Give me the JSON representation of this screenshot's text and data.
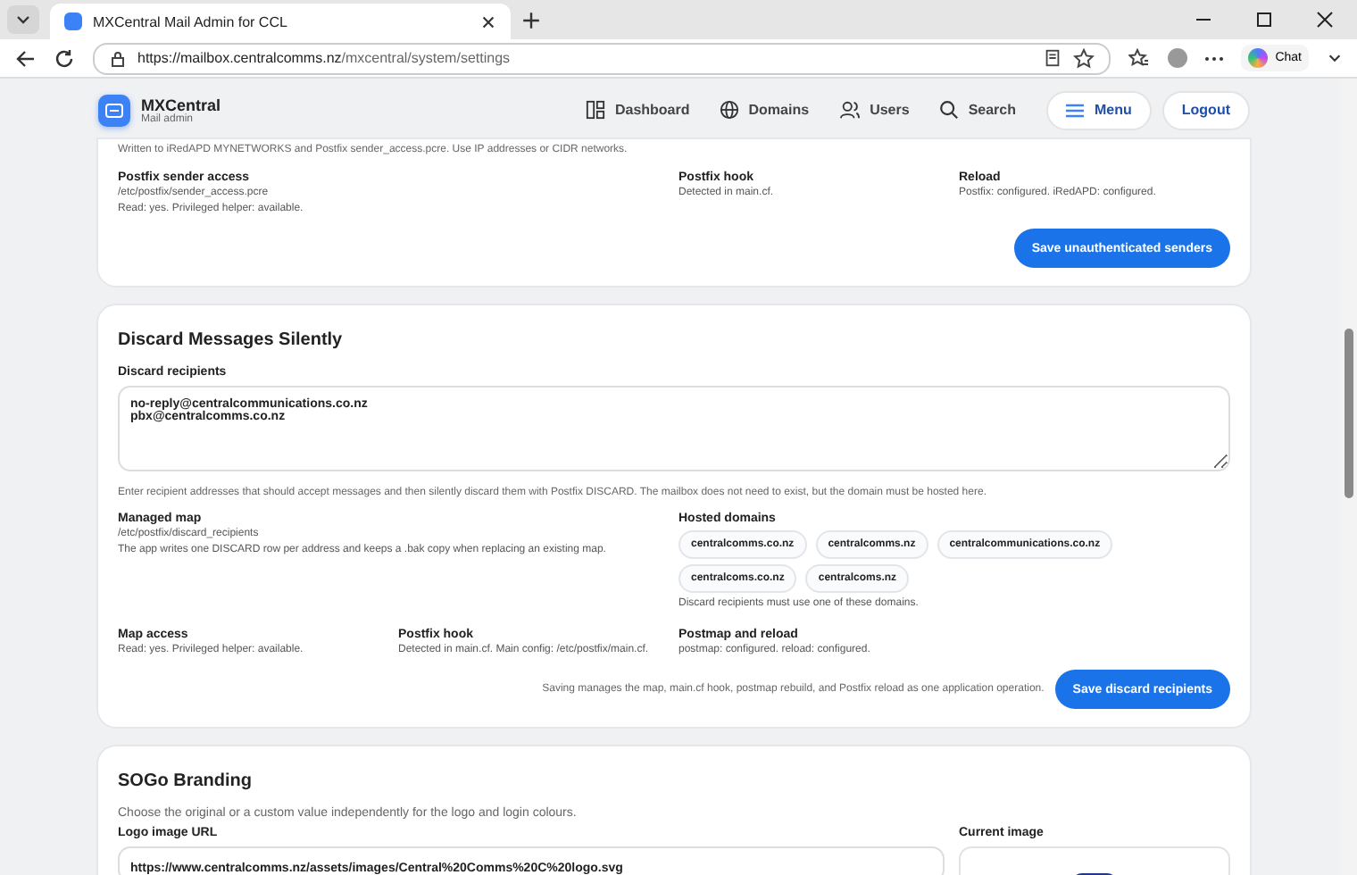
{
  "browser": {
    "tab_title": "MXCentral Mail Admin for CCL",
    "url_host": "https://mailbox.centralcomms.nz",
    "url_path": "/mxcentral/system/settings",
    "chat_label": "Chat"
  },
  "header": {
    "brand": "MXCentral",
    "subtitle": "Mail admin",
    "nav": [
      {
        "kind": "dashboard",
        "label": "Dashboard"
      },
      {
        "kind": "domains",
        "label": "Domains"
      },
      {
        "kind": "users",
        "label": "Users"
      },
      {
        "kind": "search",
        "label": "Search"
      }
    ],
    "menu": "Menu",
    "logout": "Logout"
  },
  "senders_card": {
    "note": "Written to iRedAPD MYNETWORKS and Postfix sender_access.pcre. Use IP addresses or CIDR networks.",
    "facts": [
      {
        "title": "Postfix sender access",
        "lines": [
          "/etc/postfix/sender_access.pcre",
          "Read: yes. Privileged helper: available."
        ]
      },
      {
        "title": "Postfix hook",
        "lines": [
          "Detected in main.cf."
        ]
      },
      {
        "title": "Reload",
        "lines": [
          "Postfix: configured. iRedAPD: configured."
        ]
      }
    ],
    "button": "Save unauthenticated senders"
  },
  "discard_card": {
    "title": "Discard Messages Silently",
    "field_label": "Discard recipients",
    "field_value": "no-reply@centralcommunications.co.nz\npbx@centralcomms.co.nz",
    "help": "Enter recipient addresses that should accept messages and then silently discard them with Postfix DISCARD. The mailbox does not need to exist, but the domain must be hosted here.",
    "map": {
      "title": "Managed map",
      "lines": [
        "/etc/postfix/discard_recipients",
        "The app writes one DISCARD row per address and keeps a .bak copy when replacing an existing map."
      ]
    },
    "domains_title": "Hosted domains",
    "domains": [
      "centralcomms.co.nz",
      "centralcomms.nz",
      "centralcommunications.co.nz",
      "centralcoms.co.nz",
      "centralcoms.nz"
    ],
    "domains_note": "Discard recipients must use one of these domains.",
    "facts": [
      {
        "title": "Map access",
        "lines": [
          "Read: yes. Privileged helper: available."
        ]
      },
      {
        "title": "Postfix hook",
        "lines": [
          "Detected in main.cf. Main config: /etc/postfix/main.cf."
        ]
      },
      {
        "title": "Postmap and reload",
        "lines": [
          "postmap: configured. reload: configured."
        ]
      }
    ],
    "save_note": "Saving manages the map, main.cf hook, postmap rebuild, and Postfix reload as one application operation.",
    "button": "Save discard recipients"
  },
  "branding_card": {
    "title": "SOGo Branding",
    "note": "Choose the original or a custom value independently for the logo and login colours.",
    "logo_label": "Logo image URL",
    "logo_value": "https://www.centralcomms.nz/assets/images/Central%20Comms%20C%20logo.svg",
    "current_label": "Current image"
  }
}
